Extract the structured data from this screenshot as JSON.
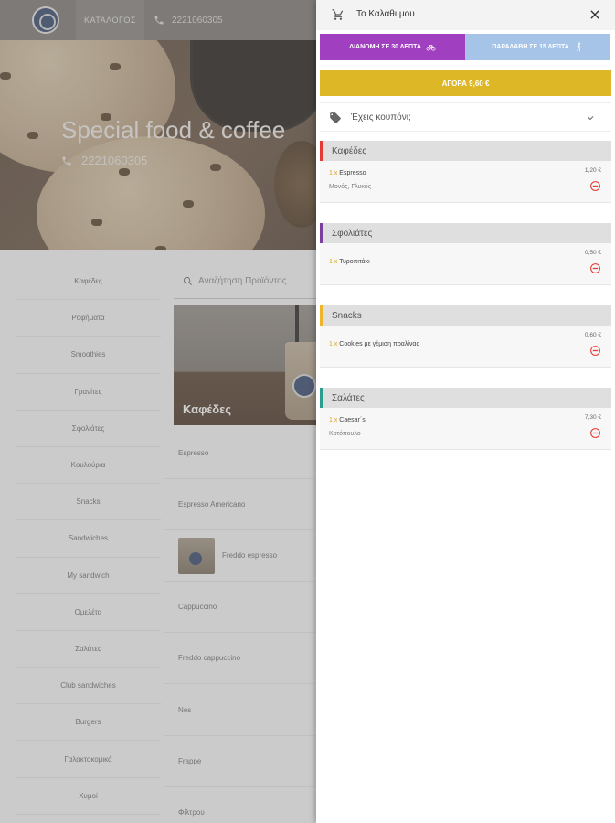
{
  "topbar": {
    "catalog_label": "ΚΑΤΑΛΟΓΟΣ",
    "phone": "2221060305"
  },
  "hero": {
    "title": "Special food & coffee",
    "phone": "2221060305"
  },
  "sidebar": {
    "categories": [
      "Καφέδες",
      "Ροφήματα",
      "Smoothies",
      "Γρανίτες",
      "Σφολιάτες",
      "Κουλούρια",
      "Snacks",
      "Sandwiches",
      "My sandwich",
      "Ομελέτα",
      "Σαλάτες",
      "Club sandwiches",
      "Burgers",
      "Γαλακτοκομικά",
      "Χυμοί"
    ]
  },
  "search": {
    "placeholder": "Αναζήτηση Προϊόντος"
  },
  "banner": {
    "label": "Καφέδες"
  },
  "products": [
    "Espresso",
    "Espresso Americano",
    "Freddo espresso",
    "Cappuccino",
    "Freddo cappuccino",
    "Nes",
    "Frappe",
    "Φίλτρου"
  ],
  "cart": {
    "title": "Το Καλάθι μου",
    "delivery_label": "ΔΙΑΝΟΜΗ ΣΕ 30 ΛΕΠΤΑ",
    "pickup_label": "ΠΑΡΑΛΑΒΗ ΣΕ 15 ΛΕΠΤΑ",
    "buy_label": "ΑΓΟΡΑ 9,60 €",
    "coupon_label": "Έχεις κουπόνι;",
    "sections": [
      {
        "name": "Καφέδες",
        "color": "#e53935",
        "items": [
          {
            "qty": "1 x",
            "name": "Espresso",
            "details": "Μονός, Γλυκός",
            "price": "1,20 €"
          }
        ]
      },
      {
        "name": "Σφολιάτες",
        "color": "#7b3fa0",
        "items": [
          {
            "qty": "1 x",
            "name": "Τυροπιτάκι",
            "details": "",
            "price": "0,50 €"
          }
        ]
      },
      {
        "name": "Snacks",
        "color": "#f0b429",
        "items": [
          {
            "qty": "1 x",
            "name": "Cookies με γέμιση πραλίνας",
            "details": "",
            "price": "0,60 €"
          }
        ]
      },
      {
        "name": "Σαλάτες",
        "color": "#2a9d8f",
        "items": [
          {
            "qty": "1 x",
            "name": "Caesar´s",
            "details": "Κοτόπουλο",
            "price": "7,30 €"
          }
        ]
      }
    ]
  },
  "colors": {
    "delivery": "#a040c0",
    "pickup": "#a6c4e8",
    "buy": "#ddb726",
    "remove": "#e53935"
  }
}
